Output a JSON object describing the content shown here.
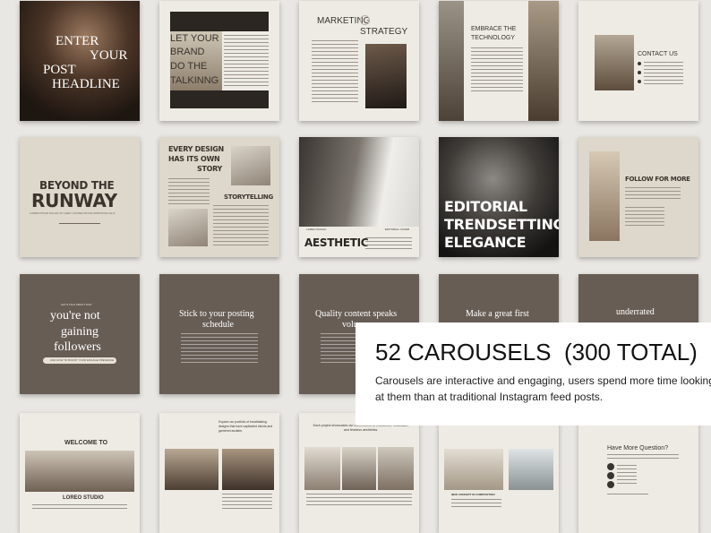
{
  "tiles": {
    "r1c1": {
      "line1": "ENTER",
      "line2": "YOUR",
      "line3": "POST",
      "line4": "HEADLINE"
    },
    "r1c2": {
      "line1": "LET YOUR",
      "line2": "BRAND",
      "line3": "DO THE",
      "line4": "TALKINNG"
    },
    "r1c3": {
      "line1": "MARKETING",
      "line2": "STRATEGY"
    },
    "r1c4": {
      "line1": "EMBRACE THE",
      "line2": "TECHNOLOGY"
    },
    "r1c5": {
      "title": "CONTACT US"
    },
    "r2c1": {
      "line1": "BEYOND THE",
      "line2": "RUNWAY",
      "sub": "LOREM IPSUM DOLOR SIT AMET CONSECTETUR ADIPISCING ELIT"
    },
    "r2c2": {
      "line1": "EVERY DESIGN",
      "line2": "HAS ITS OWN",
      "line3": "STORY",
      "side": "STORYTELLING"
    },
    "r2c3": {
      "brand": "LOREO ROUCH",
      "tag": "EDITORIAL COVER",
      "title": "AESTHETIC"
    },
    "r2c4": {
      "line1": "EDITORIAL",
      "line2": "TRENDSETTING",
      "line3": "ELEGANCE"
    },
    "r2c5": {
      "title": "FOLLOW FOR MORE"
    },
    "r3c1": {
      "kicker": "LET'S TALK ABOUT WHY",
      "line1": "you're not",
      "line2": "gaining",
      "line3": "followers",
      "pill": "AND HOW TO BOOST YOUR ENGAGE PRESENCE"
    },
    "r3c2": {
      "line1": "Stick to your posting",
      "line2": "schedule"
    },
    "r3c3": {
      "line1": "Quality content speaks",
      "line2": "volu"
    },
    "r3c4": {
      "line1": "Make a great first"
    },
    "r3c5": {
      "line1": "underrated"
    },
    "r4c1": {
      "title": "WELCOME TO",
      "brand": "LOREO STUDIO"
    },
    "r4c2": {
      "heading": "Explore our portfolio of breathtaking designs that have captivated clients and garnered acclaim."
    },
    "r4c3": {
      "heading": "Each project showcases our commitment to excellence, innovation, and timeless aesthetics."
    },
    "r4c4": {
      "caption": "NEW CONCEPT IN COMPOSITION"
    },
    "r4c5": {
      "title": "Have More Question?"
    }
  },
  "callout": {
    "heading": "52 CAROUSELS  (300 TOTAL)",
    "body_line1": "Carousels are interactive and engaging, users spend more time looking",
    "body_line2": "at them than at traditional Instagram feed posts."
  }
}
